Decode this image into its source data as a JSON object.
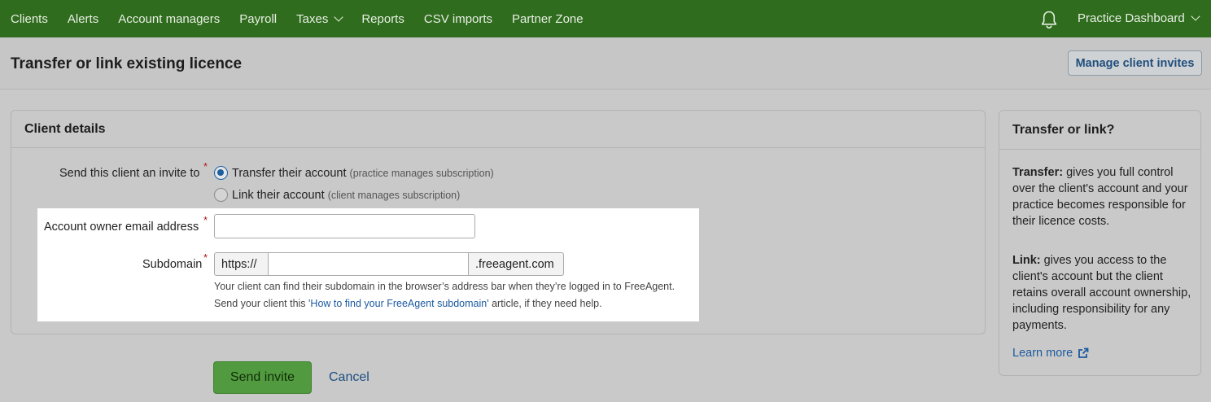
{
  "nav": {
    "items": [
      {
        "label": "Clients"
      },
      {
        "label": "Alerts"
      },
      {
        "label": "Account managers"
      },
      {
        "label": "Payroll"
      },
      {
        "label": "Taxes",
        "has_caret": true
      },
      {
        "label": "Reports"
      },
      {
        "label": "CSV imports"
      },
      {
        "label": "Partner Zone"
      }
    ],
    "dashboard_label": "Practice Dashboard"
  },
  "header": {
    "title": "Transfer or link existing licence",
    "manage_invites_label": "Manage client invites"
  },
  "form": {
    "section_title": "Client details",
    "invite_label": "Send this client an invite to",
    "required_mark": "*",
    "options": [
      {
        "label": "Transfer their account",
        "note": "(practice manages subscription)",
        "selected": true
      },
      {
        "label": "Link their account",
        "note": "(client manages subscription)",
        "selected": false
      }
    ],
    "email_label": "Account owner email address",
    "email_value": "",
    "subdomain_label": "Subdomain",
    "subdomain_prefix": "https://",
    "subdomain_value": "",
    "subdomain_suffix": ".freeagent.com",
    "help_line1": "Your client can find their subdomain in the browser’s address bar when they’re logged in to FreeAgent.",
    "help_line2_pre": "Send your client this ",
    "help_line2_link": "'How to find your FreeAgent subdomain'",
    "help_line2_post": " article, if they need help."
  },
  "actions": {
    "send_label": "Send invite",
    "cancel_label": "Cancel"
  },
  "side": {
    "title": "Transfer or link?",
    "transfer_term": "Transfer:",
    "transfer_text": " gives you full control over the client's account and your practice becomes responsible for their licence costs.",
    "link_term": "Link:",
    "link_text": " gives you access to the client's account but the client retains overall account ownership, including responsibility for any payments.",
    "learn_more": "Learn more"
  },
  "colors": {
    "nav_bg": "#2f6c1d",
    "primary_button": "#529a3f",
    "link": "#1c5aa0"
  }
}
